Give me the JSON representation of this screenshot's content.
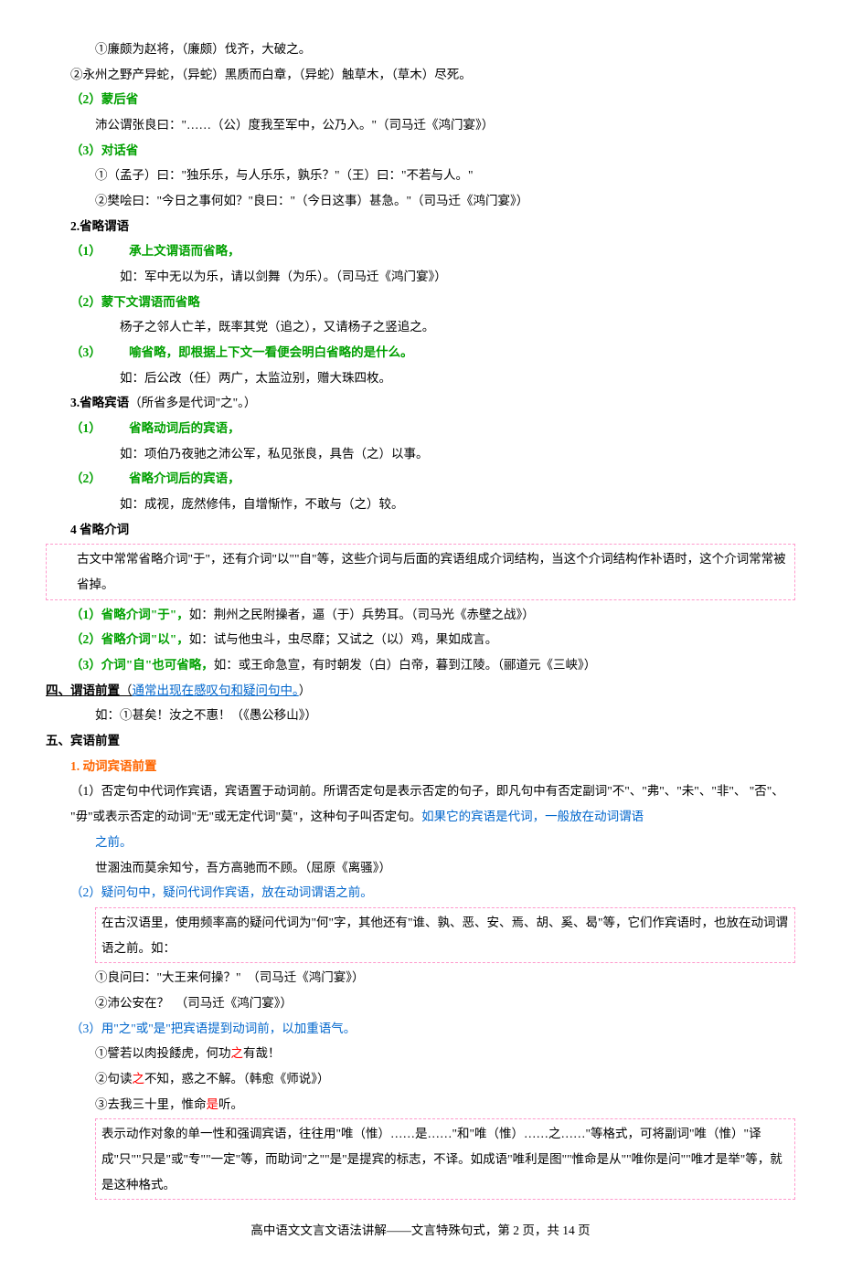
{
  "lines": {
    "l1": "①廉颇为赵将，（廉颇）伐齐，大破之。",
    "l2": "②永州之野产异蛇，（异蛇）黑质而白章，（异蛇）触草木，（草木）尽死。",
    "l3": "（2）蒙后省",
    "l4": "沛公谓张良曰：\"……（公）度我至军中，公乃入。\"（司马迁《鸿门宴》）",
    "l5": "（3）对话省",
    "l6": "①（孟子）曰：\"独乐乐，与人乐乐，孰乐？\"（王）曰：\"不若与人。\"",
    "l7": "②樊哙曰：\"今日之事何如？\"良曰：\"（今日这事）甚急。\"（司马迁《鸿门宴》）",
    "h2": "2.省略谓语",
    "l8a": "（1）",
    "l8b": "承上文谓语而省略，",
    "l9": "如：军中无以为乐，请以剑舞（为乐）。（司马迁《鸿门宴》）",
    "l10": "（2）蒙下文谓语而省略",
    "l11": "杨子之邻人亡羊，既率其党（追之），又请杨子之竖追之。",
    "l12a": "（3）",
    "l12b": "喻省略，即根据上下文一看便会明白省略的是什么。",
    "l13": "如：后公改（任）两广，太监泣别，赠大珠四枚。",
    "h3a": "3.省略宾语",
    "h3b": "（所省多是代词\"之\"。）",
    "l14a": "（1）",
    "l14b": "省略动词后的宾语，",
    "l15": "如：项伯乃夜驰之沛公军，私见张良，具告（之）以事。",
    "l16a": "（2）",
    "l16b": "省略介词后的宾语，",
    "l17": "如：成视，庞然修伟，自增惭怍，不敢与（之）较。",
    "h4": "4 省略介词",
    "box1": "古文中常常省略介词\"于\"，还有介词\"以\"\"自\"等，这些介词与后面的宾语组成介词结构，当这个介词结构作补语时，这个介词常常被省掉。",
    "l18a": "（1）省略介词\"于\"，",
    "l18b": "如：荆州之民附操者，逼（于）兵势耳。（司马光《赤壁之战》）",
    "l19a": "（2）省略介词\"以\"，",
    "l19b": "如：试与他虫斗，虫尽靡；又试之（以）鸡，果如成言。",
    "l20a": "（3）介词\"自\"也可省略，",
    "l20b": "如：或王命急宣，有时朝发（白）白帝，暮到江陵。（郦道元《三峡》）",
    "h5a": "四、谓语前置",
    "h5b": "（",
    "h5c": "通常出现在感叹句和疑问句中。",
    "h5d": "）",
    "l21": "如：①甚矣！汝之不惠！（《愚公移山》）",
    "h6": "五、宾语前置",
    "h7": "1. 动词宾语前置",
    "l22a": "（1）否定句中代词作宾语，宾语置于动词前。所谓否定句是表示否定的句子，即凡句中有否定副词\"不\"、\"弗\"、\"未\"、\"非\"、 \"否\"、 \"毋\"或表示否定的动词\"无\"或无定代词\"莫\"，这种句子叫否定句。",
    "l22b": "如果它的宾语是代词，一般放在动词谓语",
    "l22c": "之前。",
    "l23": "世溷浊而莫余知兮，吾方高驰而不顾。（屈原《离骚》）",
    "l24": "（2）疑问句中，疑问代词作宾语，放在动词谓语之前。",
    "box2": "在古汉语里，使用频率高的疑问代词为\"何\"字，其他还有\"谁、孰、恶、安、焉、胡、奚、曷\"等，它们作宾语时，也放在动词谓语之前。如：",
    "l25": "①良问曰：\"大王来何操？\"　（司马迁《鸿门宴》）",
    "l26": "②沛公安在？　（司马迁《鸿门宴》）",
    "l27": "（3）用\"之\"或\"是\"把宾语提到动词前，以加重语气。",
    "l28a": "①譬若以肉投餧虎，何功",
    "l28b": "之",
    "l28c": "有哉！",
    "l29a": "②句读",
    "l29b": "之",
    "l29c": "不知，惑之不解。（韩愈《师说》）",
    "l30a": "③去我三十里，惟命",
    "l30b": "是",
    "l30c": "听。",
    "box3": "表示动作对象的单一性和强调宾语，往往用\"唯（惟）……是……\"和\"唯（惟）……之……\"等格式，可将副词\"唯（惟）\"译成\"只\"\"只是\"或\"专\"\"一定\"等，而助词\"之\"\"是\"是提宾的标志，不译。如成语\"唯利是图\"\"惟命是从\"\"唯你是问\"\"唯才是举\"等，就是这种格式。",
    "footer": "高中语文文言文语法讲解——文言特殊句式，第 2 页，共 14 页"
  }
}
